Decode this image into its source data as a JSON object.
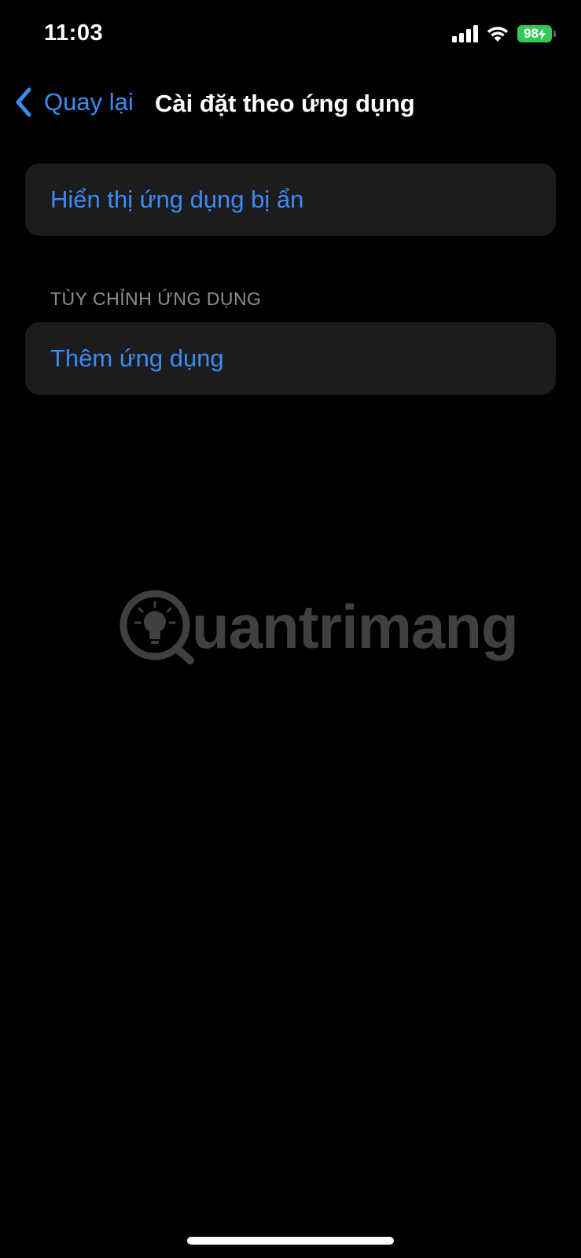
{
  "status_bar": {
    "time": "11:03",
    "battery_percent": "98",
    "battery_color": "#34c759",
    "icons": [
      "signal-icon",
      "wifi-icon",
      "battery-icon",
      "charging-bolt-icon"
    ]
  },
  "nav": {
    "back_label": "Quay lại",
    "back_icon": "chevron-left-icon",
    "title": "Cài đặt theo ứng dụng"
  },
  "cells": {
    "show_hidden_apps": "Hiển thị ứng dụng bị ẩn",
    "add_app": "Thêm ứng dụng"
  },
  "section": {
    "customize_apps_header": "TÙY CHỈNH ỨNG DỤNG"
  },
  "watermark": {
    "text": "uantrimang",
    "logo_icon": "lightbulb-icon"
  },
  "colors": {
    "accent": "#3b8cf2",
    "background": "#000000",
    "cell_background": "#1c1c1e",
    "secondary_text": "#8e8e93"
  }
}
